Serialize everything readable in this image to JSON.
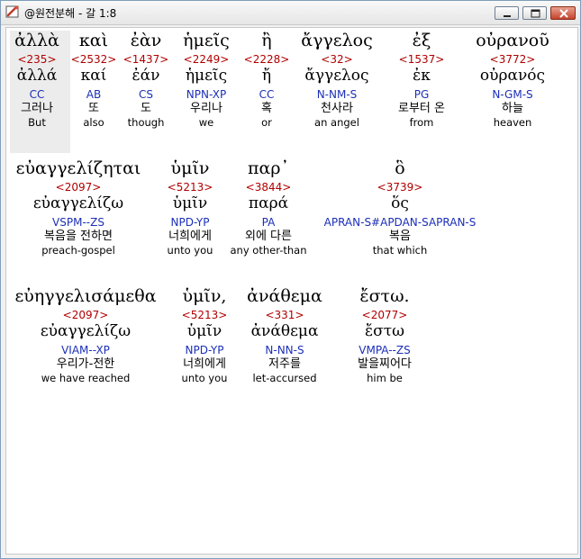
{
  "window": {
    "title": "@원전분해 - 갈 1:8",
    "buttons": {
      "minimize": "minimize-icon",
      "maximize": "maximize-icon",
      "close": "close-icon"
    }
  },
  "lines": [
    {
      "words": [
        {
          "greek": "ἀλλὰ",
          "strong": "<235>",
          "lemma": "ἀλλά",
          "parse": "CC",
          "korean": "그러나",
          "english": "But"
        },
        {
          "greek": "καὶ",
          "strong": "<2532>",
          "lemma": "καί",
          "parse": "AB",
          "korean": "또",
          "english": "also"
        },
        {
          "greek": "ἐὰν",
          "strong": "<1437>",
          "lemma": "ἐάν",
          "parse": "CS",
          "korean": "도",
          "english": "though"
        },
        {
          "greek": "ἡμεῖς",
          "strong": "<2249>",
          "lemma": "ἡμεῖς",
          "parse": "NPN-XP",
          "korean": "우리나",
          "english": "we"
        },
        {
          "greek": "ἢ",
          "strong": "<2228>",
          "lemma": "ἤ",
          "parse": "CC",
          "korean": "혹",
          "english": "or"
        },
        {
          "greek": "ἄγγελος",
          "strong": "<32>",
          "lemma": "ἄγγελος",
          "parse": "N-NM-S",
          "korean": "천사라",
          "english": "an angel"
        },
        {
          "greek": "ἐξ",
          "strong": "<1537>",
          "lemma": "ἐκ",
          "parse": "PG",
          "korean": "로부터 온",
          "english": "from"
        },
        {
          "greek": "οὐρανοῦ",
          "strong": "<3772>",
          "lemma": "οὐρανός",
          "parse": "N-GM-S",
          "korean": "하늘",
          "english": "heaven"
        }
      ]
    },
    {
      "words": [
        {
          "greek": "εὐαγγελίζηται",
          "strong": "<2097>",
          "lemma": "εὐαγγελίζω",
          "parse": "VSPM--ZS",
          "korean": "복음을 전하면",
          "english": "preach-gospel"
        },
        {
          "greek": "ὑμῖν",
          "strong": "<5213>",
          "lemma": "ὑμῖν",
          "parse": "NPD-YP",
          "korean": "너희에게",
          "english": "unto you"
        },
        {
          "greek": "παρ᾽",
          "strong": "<3844>",
          "lemma": "παρά",
          "parse": "PA",
          "korean": "외에 다른",
          "english": "any other-than"
        },
        {
          "greek": "ὃ",
          "strong": "<3739>",
          "lemma": "ὅς",
          "parse": "APRAN-S#APDAN-SAPRAN-S",
          "korean": "복음",
          "english": "that which"
        }
      ]
    },
    {
      "words": [
        {
          "greek": "εὐηγγελισάμεθα",
          "strong": "<2097>",
          "lemma": "εὐαγγελίζω",
          "parse": "VIAM--XP",
          "korean": "우리가-전한",
          "english": "we have reached"
        },
        {
          "greek": "ὑμῖν,",
          "strong": "<5213>",
          "lemma": "ὑμῖν",
          "parse": "NPD-YP",
          "korean": "너희에게",
          "english": "unto you"
        },
        {
          "greek": "ἀνάθεμα",
          "strong": "<331>",
          "lemma": "ἀνάθεμα",
          "parse": "N-NN-S",
          "korean": "저주를",
          "english": "let-accursed"
        },
        {
          "greek": "ἔστω.",
          "strong": "<2077>",
          "lemma": "ἔστω",
          "parse": "VMPA--ZS",
          "korean": "발을찌어다",
          "english": "him be"
        }
      ]
    }
  ]
}
